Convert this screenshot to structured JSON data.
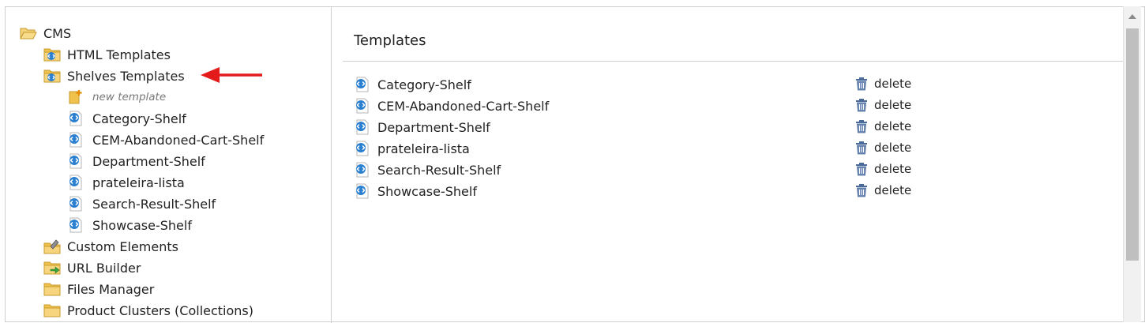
{
  "tree": {
    "root": {
      "label": "CMS",
      "icon": "open-folder-icon"
    },
    "items": [
      {
        "label": "HTML Templates",
        "icon": "templates-folder-icon"
      },
      {
        "label": "Shelves Templates",
        "icon": "templates-folder-icon"
      },
      {
        "label": "new template",
        "icon": "new-template-icon"
      },
      {
        "label": "Category-Shelf",
        "icon": "template-file-icon"
      },
      {
        "label": "CEM-Abandoned-Cart-Shelf",
        "icon": "template-file-icon"
      },
      {
        "label": "Department-Shelf",
        "icon": "template-file-icon"
      },
      {
        "label": "prateleira-lista",
        "icon": "template-file-icon"
      },
      {
        "label": "Search-Result-Shelf",
        "icon": "template-file-icon"
      },
      {
        "label": "Showcase-Shelf",
        "icon": "template-file-icon"
      },
      {
        "label": "Custom Elements",
        "icon": "custom-elements-folder-icon"
      },
      {
        "label": "URL Builder",
        "icon": "url-builder-folder-icon"
      },
      {
        "label": "Files Manager",
        "icon": "folder-icon"
      },
      {
        "label": "Product Clusters (Collections)",
        "icon": "folder-icon"
      }
    ]
  },
  "main": {
    "title": "Templates",
    "delete_label": "delete",
    "rows": [
      {
        "name": "Category-Shelf"
      },
      {
        "name": "CEM-Abandoned-Cart-Shelf"
      },
      {
        "name": "Department-Shelf"
      },
      {
        "name": "prateleira-lista"
      },
      {
        "name": "Search-Result-Shelf"
      },
      {
        "name": "Showcase-Shelf"
      }
    ]
  },
  "colors": {
    "arrow": "#e31b1b",
    "folder": "#f0c14b",
    "file_icon": "#2a7fd0",
    "trash": "#4a6a9a"
  }
}
